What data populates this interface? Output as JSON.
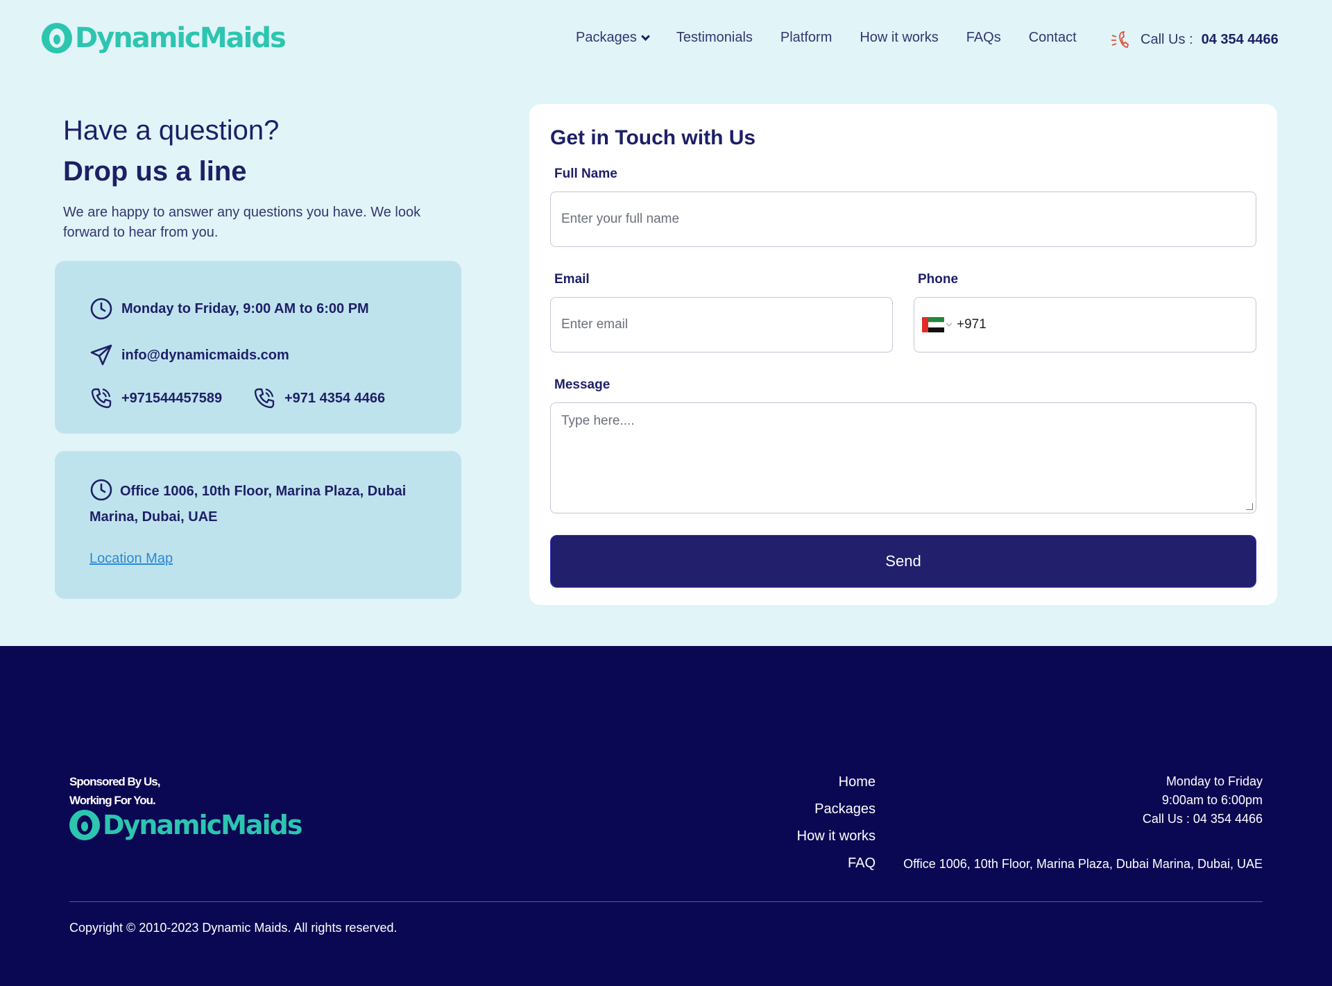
{
  "brand": {
    "name": "DynamicMaids",
    "accent": "#2cc5b0",
    "navy": "#1d1f66",
    "footer_bg": "#0b0853"
  },
  "nav": {
    "items": [
      "Packages",
      "Testimonials",
      "Platform",
      "How it works",
      "FAQs",
      "Contact"
    ],
    "call_label": "Call Us :",
    "call_number": "04 354 4466"
  },
  "intro": {
    "question": "Have a question?",
    "heading": "Drop us a line",
    "text": "We are happy to answer any questions you have. We look forward to hear from you."
  },
  "contact_card": {
    "hours": "Monday to Friday, 9:00 AM to 6:00 PM",
    "email": "info@dynamicmaids.com",
    "phone1": "+971544457589",
    "phone2": "+971 4354 4466"
  },
  "address_card": {
    "address": "Office 1006, 10th Floor, Marina Plaza, Dubai Marina, Dubai, UAE",
    "map_link": "Location Map"
  },
  "form": {
    "title": "Get in Touch with Us",
    "full_name_label": "Full Name",
    "full_name_placeholder": "Enter your full name",
    "email_label": "Email",
    "email_placeholder": "Enter email",
    "phone_label": "Phone",
    "phone_value": "+971",
    "message_label": "Message",
    "message_placeholder": "Type here....",
    "send_label": "Send"
  },
  "footer": {
    "slogan_line1": "Sponsored By Us,",
    "slogan_line2": "Working For You.",
    "links": [
      "Home",
      "Packages",
      "How it works",
      "FAQ"
    ],
    "days": "Monday to Friday",
    "hours": "9:00am to 6:00pm",
    "call": "Call Us : 04 354 4466",
    "address": "Office 1006, 10th Floor, Marina Plaza, Dubai Marina, Dubai, UAE",
    "copyright": "Copyright © 2010-2023 Dynamic Maids. All rights reserved."
  }
}
